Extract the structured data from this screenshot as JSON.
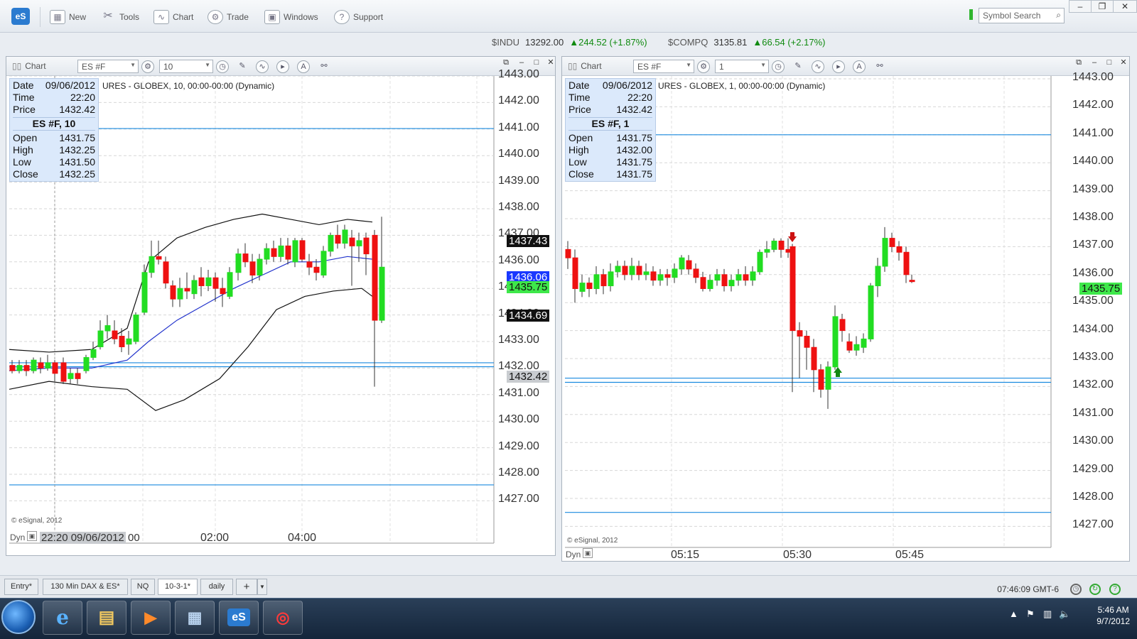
{
  "app": {
    "logo": "eS",
    "toolbar": [
      {
        "label": "New",
        "icon": "new-chart-icon"
      },
      {
        "label": "Tools",
        "icon": "tools-icon"
      },
      {
        "label": "Chart",
        "icon": "chart-icon"
      },
      {
        "label": "Trade",
        "icon": "trade-icon"
      },
      {
        "label": "Windows",
        "icon": "windows-icon"
      },
      {
        "label": "Support",
        "icon": "help-icon"
      }
    ],
    "symbol_search_placeholder": "Symbol Search"
  },
  "tickers": [
    {
      "symbol": "$INDU",
      "price": "13292.00",
      "change": "▲244.52 (+1.87%)"
    },
    {
      "symbol": "$COMPQ",
      "price": "3135.81",
      "change": "▲66.54 (+2.17%)"
    }
  ],
  "charts": [
    {
      "header_title": "Chart",
      "symbol": "ES #F",
      "interval": "10",
      "chart_title": "URES - GLOBEX, 10, 00:00-00:00 (Dynamic)",
      "databox": {
        "date_label": "Date",
        "date": "09/06/2012",
        "time_label": "Time",
        "time": "22:20",
        "price_label": "Price",
        "price": "1432.42",
        "heading": "ES #F, 10",
        "open_label": "Open",
        "open": "1431.75",
        "high_label": "High",
        "high": "1432.25",
        "low_label": "Low",
        "low": "1431.50",
        "close_label": "Close",
        "close": "1432.25"
      },
      "yticks": [
        "1443.00",
        "1442.00",
        "1441.00",
        "1440.00",
        "1439.00",
        "1438.00",
        "1437.00",
        "1436.00",
        "1435.00",
        "1434.00",
        "1433.00",
        "1432.00",
        "1431.00",
        "1430.00",
        "1429.00",
        "1428.00",
        "1427.00"
      ],
      "price_tags": [
        {
          "label": "1437.43",
          "style": "black"
        },
        {
          "label": "1436.06",
          "style": "blue"
        },
        {
          "label": "1435.75",
          "style": "green"
        },
        {
          "label": "1434.69",
          "style": "black"
        },
        {
          "label": "1432.42",
          "style": "gray"
        }
      ],
      "xticks": [
        "22:20 09/06/2012",
        "00",
        "02:00",
        "04:00"
      ],
      "dyn": "Dyn",
      "copyright": "© eSignal, 2012"
    },
    {
      "header_title": "Chart",
      "symbol": "ES #F",
      "interval": "1",
      "chart_title": "URES - GLOBEX, 1, 00:00-00:00 (Dynamic)",
      "databox": {
        "date_label": "Date",
        "date": "09/06/2012",
        "time_label": "Time",
        "time": "22:20",
        "price_label": "Price",
        "price": "1432.42",
        "heading": "ES #F, 1",
        "open_label": "Open",
        "open": "1431.75",
        "high_label": "High",
        "high": "1432.00",
        "low_label": "Low",
        "low": "1431.75",
        "close_label": "Close",
        "close": "1431.75"
      },
      "yticks": [
        "1443.00",
        "1442.00",
        "1441.00",
        "1440.00",
        "1439.00",
        "1438.00",
        "1437.00",
        "1436.00",
        "1435.00",
        "1434.00",
        "1433.00",
        "1432.00",
        "1431.00",
        "1430.00",
        "1429.00",
        "1428.00",
        "1427.00"
      ],
      "price_tags": [
        {
          "label": "1435.75",
          "style": "green"
        }
      ],
      "xticks": [
        "05:15",
        "05:30",
        "05:45"
      ],
      "dyn": "Dyn",
      "copyright": "© eSignal, 2012"
    }
  ],
  "tabs": [
    "Entry*",
    "130 Min DAX & ES*",
    "NQ",
    "10-3-1*",
    "daily",
    "+"
  ],
  "status_clock": "07:46:09 GMT-6",
  "taskbar": {
    "apps": [
      "internet-explorer",
      "file-explorer",
      "media-player",
      "network-monitor",
      "esignal",
      "other-app"
    ],
    "esignal_label": "eS",
    "time": "5:46 AM",
    "date": "9/7/2012"
  },
  "colors": {
    "up_candle": "#22dd22",
    "down_candle": "#ee1111",
    "level_line": "#1a8adf",
    "ma_line": "#2233cc",
    "band_line": "#111111"
  }
}
